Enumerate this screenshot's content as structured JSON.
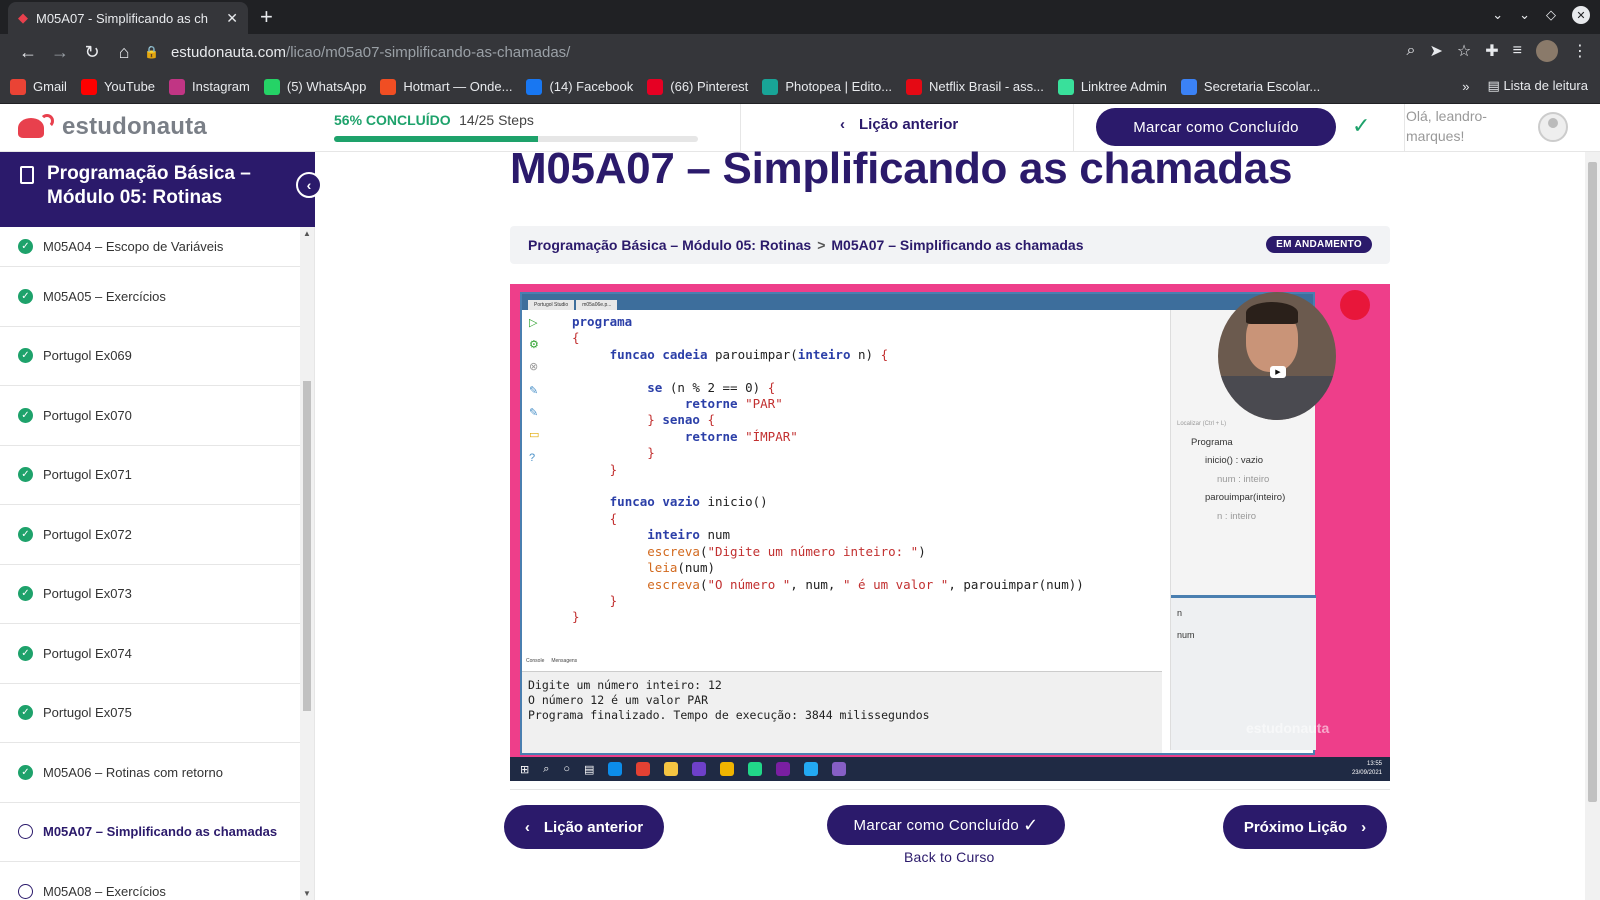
{
  "browser": {
    "tab_title": "M05A07 - Simplificando as ch",
    "url_domain": "estudonauta.com",
    "url_path": "/licao/m05a07-simplificando-as-chamadas/",
    "bookmarks": [
      {
        "label": "Gmail",
        "color": "#ea4335"
      },
      {
        "label": "YouTube",
        "color": "#ff0000"
      },
      {
        "label": "Instagram",
        "color": "#c13584"
      },
      {
        "label": "(5) WhatsApp",
        "color": "#25d366"
      },
      {
        "label": "Hotmart — Onde...",
        "color": "#f04e23"
      },
      {
        "label": "(14) Facebook",
        "color": "#1877f2"
      },
      {
        "label": "(66) Pinterest",
        "color": "#e60023"
      },
      {
        "label": "Photopea | Edito...",
        "color": "#18a497"
      },
      {
        "label": "Netflix Brasil - ass...",
        "color": "#e50914"
      },
      {
        "label": "Linktree Admin",
        "color": "#39e09b"
      },
      {
        "label": "Secretaria Escolar...",
        "color": "#3b82f6"
      }
    ],
    "reading_list": "Lista de leitura"
  },
  "header": {
    "logo_text": "estudonauta",
    "progress_pct": "56% CONCLUÍDO",
    "progress_steps": "14/25 Steps",
    "progress_fraction": 0.56,
    "prev_lesson": "Lição anterior",
    "mark_complete": "Marcar como Concluído",
    "user_greeting": "Olá, leandro-marques!"
  },
  "sidebar": {
    "course_title": "Programação Básica – Módulo 05: Rotinas",
    "items": [
      {
        "label": "M05A04 – Escopo de Variáveis",
        "done": true
      },
      {
        "label": "M05A05 – Exercícios",
        "done": true
      },
      {
        "label": "Portugol Ex069",
        "done": true
      },
      {
        "label": "Portugol Ex070",
        "done": true
      },
      {
        "label": "Portugol Ex071",
        "done": true
      },
      {
        "label": "Portugol Ex072",
        "done": true
      },
      {
        "label": "Portugol Ex073",
        "done": true
      },
      {
        "label": "Portugol Ex074",
        "done": true
      },
      {
        "label": "Portugol Ex075",
        "done": true
      },
      {
        "label": "M05A06 – Rotinas com retorno",
        "done": true
      },
      {
        "label": "M05A07 – Simplificando as chamadas",
        "done": false,
        "current": true
      },
      {
        "label": "M05A08 – Exercícios",
        "done": false
      }
    ]
  },
  "main": {
    "title": "M05A07 – Simplificando as chamadas",
    "breadcrumb_course": "Programação Básica – Módulo 05: Rotinas",
    "breadcrumb_sep": ">",
    "breadcrumb_lesson": "M05A07 – Simplificando as chamadas",
    "status_badge": "EM ANDAMENTO",
    "btn_prev": "Lição anterior",
    "btn_mark": "Marcar como Concluído",
    "back_link": "Back to Curso",
    "btn_next": "Próximo Lição"
  },
  "video": {
    "ide_tab1": "Portugol Studio",
    "ide_tab2": "m05a06e.p...",
    "console_tab1": "Console",
    "console_tab2": "Mensagens",
    "console_output": "Digite um número inteiro: 12\nO número 12 é um valor PAR\nPrograma finalizado. Tempo de execução: 3844 milissegundos",
    "tree_search": "Localizar (Ctrl + L)",
    "tree_program": "Programa",
    "tree_inicio": "inicio() : vazio",
    "tree_num": "num : inteiro",
    "tree_parouimpar": "parouimpar(inteiro)",
    "tree_n": "n : inteiro",
    "vars_n": "n",
    "vars_num": "num",
    "watermark": "estudonauta",
    "clock_time": "13:55",
    "clock_date": "23/09/2021"
  }
}
